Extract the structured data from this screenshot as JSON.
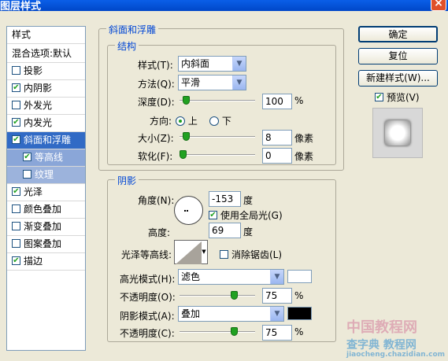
{
  "window": {
    "title": "图层样式",
    "close_glyph": "×"
  },
  "sidebar": {
    "header": "样式",
    "blend": "混合选项:默认",
    "items": [
      {
        "label": "投影",
        "checked": false
      },
      {
        "label": "内阴影",
        "checked": true
      },
      {
        "label": "外发光",
        "checked": false
      },
      {
        "label": "内发光",
        "checked": true
      },
      {
        "label": "斜面和浮雕",
        "checked": true
      },
      {
        "label": "等高线",
        "checked": true
      },
      {
        "label": "纹理",
        "checked": false
      },
      {
        "label": "光泽",
        "checked": true
      },
      {
        "label": "颜色叠加",
        "checked": false
      },
      {
        "label": "渐变叠加",
        "checked": false
      },
      {
        "label": "图案叠加",
        "checked": false
      },
      {
        "label": "描边",
        "checked": true
      }
    ]
  },
  "bevel": {
    "group_label": "斜面和浮雕",
    "struct_label": "结构",
    "style_label": "样式(T):",
    "style_value": "内斜面",
    "method_label": "方法(Q):",
    "method_value": "平滑",
    "depth_label": "深度(D):",
    "depth_value": "100",
    "depth_unit": "%",
    "depth_level": 0.05,
    "direction_label": "方向:",
    "direction_up": "上",
    "direction_down": "下",
    "direction_selected": "上",
    "size_label": "大小(Z):",
    "size_value": "8",
    "size_unit": "像素",
    "size_level": 0.05,
    "soften_label": "软化(F):",
    "soften_value": "0",
    "soften_unit": "像素",
    "soften_level": 0.0
  },
  "shading": {
    "group_label": "阴影",
    "angle_label": "角度(N):",
    "angle_value": "-153",
    "angle_unit": "度",
    "global_light_label": "使用全局光(G)",
    "global_light_checked": true,
    "altitude_label": "高度:",
    "altitude_value": "69",
    "altitude_unit": "度",
    "gloss_label": "光泽等高线:",
    "antialias_label": "消除锯齿(L)",
    "antialias_checked": false,
    "highlight_mode_label": "高光模式(H):",
    "highlight_mode_value": "滤色",
    "highlight_color": "#ffffff",
    "highlight_opacity_label": "不透明度(O):",
    "highlight_opacity_value": "75",
    "highlight_opacity_unit": "%",
    "highlight_opacity_level": 0.75,
    "shadow_mode_label": "阴影模式(A):",
    "shadow_mode_value": "叠加",
    "shadow_color": "#000000",
    "shadow_opacity_label": "不透明度(C):",
    "shadow_opacity_value": "75",
    "shadow_opacity_unit": "%",
    "shadow_opacity_level": 0.75
  },
  "buttons": {
    "ok": "确定",
    "reset": "复位",
    "new_style": "新建样式(W)...",
    "preview_label": "预览(V)",
    "preview_checked": true
  },
  "watermark": {
    "line1": "中国教程网",
    "line2": "查字典 教程网",
    "line3": "jiaocheng.chazidian.com"
  },
  "accent": "#316ac5",
  "check_color": "#21a121",
  "icons": {
    "close": "close-icon",
    "dropdown": "chevron-down-icon",
    "check": "check-icon",
    "radio": "radio-icon",
    "slider": "slider-thumb-icon"
  }
}
